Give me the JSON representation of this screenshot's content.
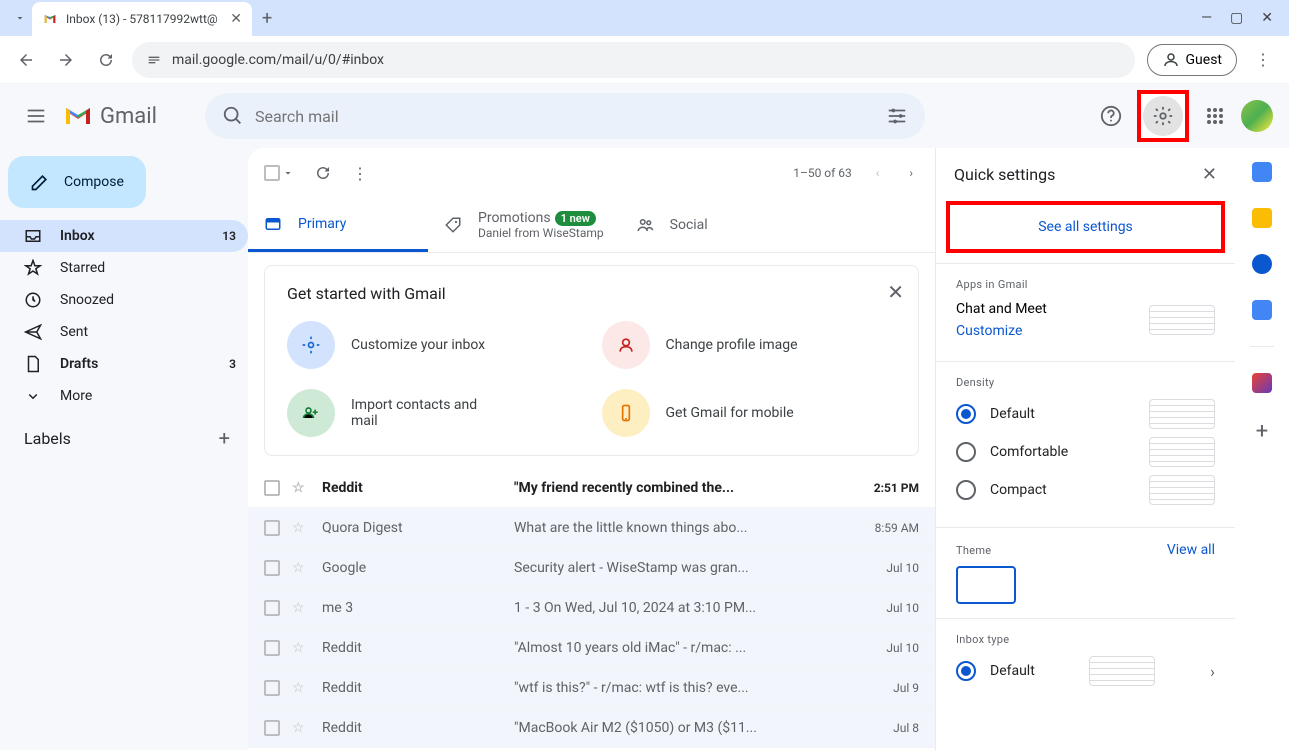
{
  "browser": {
    "tab_title": "Inbox (13) - 578117992wtt@",
    "url": "mail.google.com/mail/u/0/#inbox",
    "guest_label": "Guest"
  },
  "header": {
    "logo_text": "Gmail",
    "search_placeholder": "Search mail"
  },
  "sidebar": {
    "compose_label": "Compose",
    "items": [
      {
        "label": "Inbox",
        "count": "13",
        "active": true,
        "bold": true,
        "icon": "inbox"
      },
      {
        "label": "Starred",
        "count": "",
        "active": false,
        "bold": false,
        "icon": "star"
      },
      {
        "label": "Snoozed",
        "count": "",
        "active": false,
        "bold": false,
        "icon": "clock"
      },
      {
        "label": "Sent",
        "count": "",
        "active": false,
        "bold": false,
        "icon": "send"
      },
      {
        "label": "Drafts",
        "count": "3",
        "active": false,
        "bold": true,
        "icon": "file"
      },
      {
        "label": "More",
        "count": "",
        "active": false,
        "bold": false,
        "icon": "chevron-down"
      }
    ],
    "labels_heading": "Labels"
  },
  "toolbar": {
    "pagination": "1–50 of 63"
  },
  "tabs": [
    {
      "label": "Primary",
      "sub": "",
      "badge": "",
      "active": true,
      "icon": "primary"
    },
    {
      "label": "Promotions",
      "sub": "Daniel from WiseStamp",
      "badge": "1 new",
      "active": false,
      "icon": "promo"
    },
    {
      "label": "Social",
      "sub": "",
      "badge": "",
      "active": false,
      "icon": "social"
    }
  ],
  "get_started": {
    "title": "Get started with Gmail",
    "items": [
      {
        "text": "Customize your inbox",
        "color": "#d3e3fd"
      },
      {
        "text": "Change profile image",
        "color": "#fce8e6"
      },
      {
        "text": "Import contacts and mail",
        "color": "#ceead6"
      },
      {
        "text": "Get Gmail for mobile",
        "color": "#feefc3"
      }
    ]
  },
  "emails": [
    {
      "sender": "Reddit",
      "subject": "\"My friend recently combined the...",
      "snippet": "",
      "date": "2:51 PM",
      "unread": true
    },
    {
      "sender": "Quora Digest",
      "subject": "What are the little known things abo...",
      "snippet": "",
      "date": "8:59 AM",
      "unread": false
    },
    {
      "sender": "Google",
      "subject": "Security alert",
      "snippet": " - WiseStamp was gran...",
      "date": "Jul 10",
      "unread": false
    },
    {
      "sender": "me",
      "sender_extra": "3",
      "subject": "1",
      "snippet": " - 3 On Wed, Jul 10, 2024 at 3:10 PM...",
      "date": "Jul 10",
      "unread": false
    },
    {
      "sender": "Reddit",
      "subject": "\"Almost 10 years old iMac\"",
      "snippet": " - r/mac: ...",
      "date": "Jul 10",
      "unread": false
    },
    {
      "sender": "Reddit",
      "subject": "\"wtf is this?\"",
      "snippet": " - r/mac: wtf is this? eve...",
      "date": "Jul 9",
      "unread": false
    },
    {
      "sender": "Reddit",
      "subject": "\"MacBook Air M2 ($1050) or M3 ($11...",
      "snippet": "",
      "date": "Jul 8",
      "unread": false
    }
  ],
  "quick_settings": {
    "title": "Quick settings",
    "see_all": "See all settings",
    "apps_heading": "Apps in Gmail",
    "chat_meet": "Chat and Meet",
    "customize": "Customize",
    "density_heading": "Density",
    "density_options": [
      "Default",
      "Comfortable",
      "Compact"
    ],
    "theme_heading": "Theme",
    "view_all": "View all",
    "inbox_type_heading": "Inbox type",
    "inbox_type_default": "Default"
  }
}
